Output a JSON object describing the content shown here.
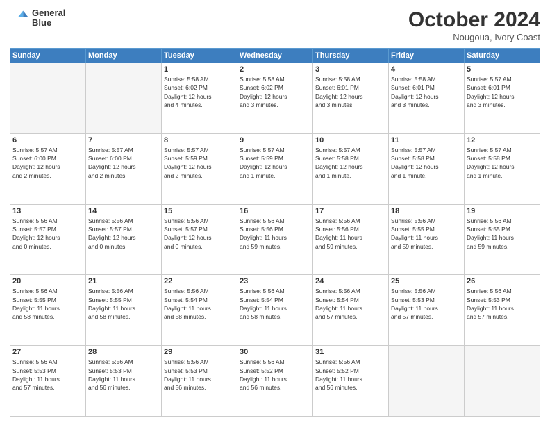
{
  "header": {
    "logo_line1": "General",
    "logo_line2": "Blue",
    "month": "October 2024",
    "location": "Nougoua, Ivory Coast"
  },
  "weekdays": [
    "Sunday",
    "Monday",
    "Tuesday",
    "Wednesday",
    "Thursday",
    "Friday",
    "Saturday"
  ],
  "weeks": [
    [
      {
        "day": "",
        "info": ""
      },
      {
        "day": "",
        "info": ""
      },
      {
        "day": "1",
        "info": "Sunrise: 5:58 AM\nSunset: 6:02 PM\nDaylight: 12 hours\nand 4 minutes."
      },
      {
        "day": "2",
        "info": "Sunrise: 5:58 AM\nSunset: 6:02 PM\nDaylight: 12 hours\nand 3 minutes."
      },
      {
        "day": "3",
        "info": "Sunrise: 5:58 AM\nSunset: 6:01 PM\nDaylight: 12 hours\nand 3 minutes."
      },
      {
        "day": "4",
        "info": "Sunrise: 5:58 AM\nSunset: 6:01 PM\nDaylight: 12 hours\nand 3 minutes."
      },
      {
        "day": "5",
        "info": "Sunrise: 5:57 AM\nSunset: 6:01 PM\nDaylight: 12 hours\nand 3 minutes."
      }
    ],
    [
      {
        "day": "6",
        "info": "Sunrise: 5:57 AM\nSunset: 6:00 PM\nDaylight: 12 hours\nand 2 minutes."
      },
      {
        "day": "7",
        "info": "Sunrise: 5:57 AM\nSunset: 6:00 PM\nDaylight: 12 hours\nand 2 minutes."
      },
      {
        "day": "8",
        "info": "Sunrise: 5:57 AM\nSunset: 5:59 PM\nDaylight: 12 hours\nand 2 minutes."
      },
      {
        "day": "9",
        "info": "Sunrise: 5:57 AM\nSunset: 5:59 PM\nDaylight: 12 hours\nand 1 minute."
      },
      {
        "day": "10",
        "info": "Sunrise: 5:57 AM\nSunset: 5:58 PM\nDaylight: 12 hours\nand 1 minute."
      },
      {
        "day": "11",
        "info": "Sunrise: 5:57 AM\nSunset: 5:58 PM\nDaylight: 12 hours\nand 1 minute."
      },
      {
        "day": "12",
        "info": "Sunrise: 5:57 AM\nSunset: 5:58 PM\nDaylight: 12 hours\nand 1 minute."
      }
    ],
    [
      {
        "day": "13",
        "info": "Sunrise: 5:56 AM\nSunset: 5:57 PM\nDaylight: 12 hours\nand 0 minutes."
      },
      {
        "day": "14",
        "info": "Sunrise: 5:56 AM\nSunset: 5:57 PM\nDaylight: 12 hours\nand 0 minutes."
      },
      {
        "day": "15",
        "info": "Sunrise: 5:56 AM\nSunset: 5:57 PM\nDaylight: 12 hours\nand 0 minutes."
      },
      {
        "day": "16",
        "info": "Sunrise: 5:56 AM\nSunset: 5:56 PM\nDaylight: 11 hours\nand 59 minutes."
      },
      {
        "day": "17",
        "info": "Sunrise: 5:56 AM\nSunset: 5:56 PM\nDaylight: 11 hours\nand 59 minutes."
      },
      {
        "day": "18",
        "info": "Sunrise: 5:56 AM\nSunset: 5:55 PM\nDaylight: 11 hours\nand 59 minutes."
      },
      {
        "day": "19",
        "info": "Sunrise: 5:56 AM\nSunset: 5:55 PM\nDaylight: 11 hours\nand 59 minutes."
      }
    ],
    [
      {
        "day": "20",
        "info": "Sunrise: 5:56 AM\nSunset: 5:55 PM\nDaylight: 11 hours\nand 58 minutes."
      },
      {
        "day": "21",
        "info": "Sunrise: 5:56 AM\nSunset: 5:55 PM\nDaylight: 11 hours\nand 58 minutes."
      },
      {
        "day": "22",
        "info": "Sunrise: 5:56 AM\nSunset: 5:54 PM\nDaylight: 11 hours\nand 58 minutes."
      },
      {
        "day": "23",
        "info": "Sunrise: 5:56 AM\nSunset: 5:54 PM\nDaylight: 11 hours\nand 58 minutes."
      },
      {
        "day": "24",
        "info": "Sunrise: 5:56 AM\nSunset: 5:54 PM\nDaylight: 11 hours\nand 57 minutes."
      },
      {
        "day": "25",
        "info": "Sunrise: 5:56 AM\nSunset: 5:53 PM\nDaylight: 11 hours\nand 57 minutes."
      },
      {
        "day": "26",
        "info": "Sunrise: 5:56 AM\nSunset: 5:53 PM\nDaylight: 11 hours\nand 57 minutes."
      }
    ],
    [
      {
        "day": "27",
        "info": "Sunrise: 5:56 AM\nSunset: 5:53 PM\nDaylight: 11 hours\nand 57 minutes."
      },
      {
        "day": "28",
        "info": "Sunrise: 5:56 AM\nSunset: 5:53 PM\nDaylight: 11 hours\nand 56 minutes."
      },
      {
        "day": "29",
        "info": "Sunrise: 5:56 AM\nSunset: 5:53 PM\nDaylight: 11 hours\nand 56 minutes."
      },
      {
        "day": "30",
        "info": "Sunrise: 5:56 AM\nSunset: 5:52 PM\nDaylight: 11 hours\nand 56 minutes."
      },
      {
        "day": "31",
        "info": "Sunrise: 5:56 AM\nSunset: 5:52 PM\nDaylight: 11 hours\nand 56 minutes."
      },
      {
        "day": "",
        "info": ""
      },
      {
        "day": "",
        "info": ""
      }
    ]
  ]
}
